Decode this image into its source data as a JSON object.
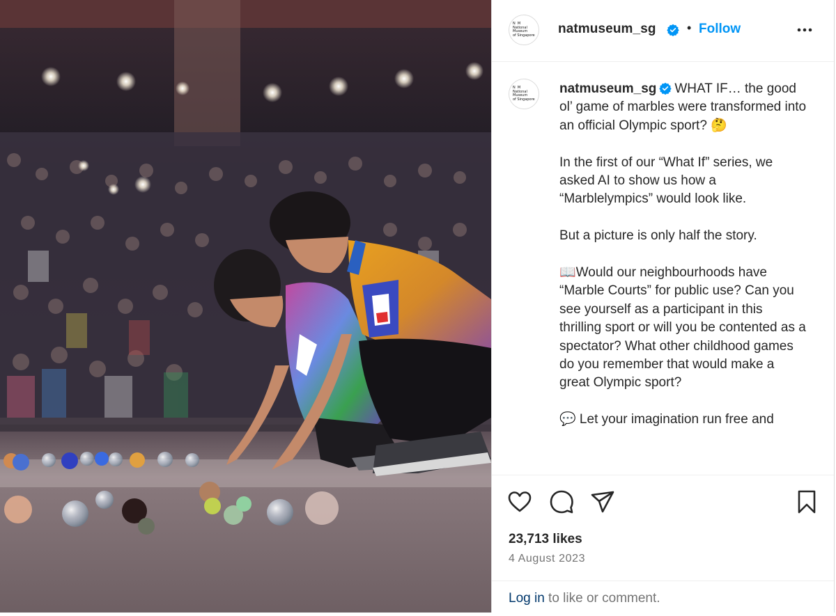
{
  "post": {
    "username": "natmuseum_sg",
    "avatar_alt": "National Museum of Singapore logo",
    "follow_label": "Follow",
    "separator": "•",
    "caption_paragraphs": [
      "WHAT IF… the good ol’ game of marbles were transformed into an official Olympic sport? 🤔",
      "In the first of our “What If” series, we asked AI to show us how a “Marblelympics” would look like.",
      "But a picture is only half the story.",
      "📖Would our neighbourhoods have “Marble Courts” for public use? Can you see yourself as a participant in this thrilling sport or will you be contented as a spectator? What other childhood games do you remember that would make a great Olympic sport?",
      "💬 Let your imagination run free and"
    ],
    "likes": "23,713 likes",
    "date": "4 August 2023",
    "login_link": "Log in",
    "login_rest": " to like or comment."
  },
  "icons": {
    "verified": "verified-badge-icon",
    "more": "more-options-icon",
    "like": "heart-icon",
    "comment": "comment-icon",
    "share": "share-icon",
    "save": "bookmark-icon"
  },
  "colors": {
    "follow": "#0095f6",
    "verified": "#0095f6",
    "link": "#00376b",
    "muted": "#737373",
    "text": "#262626"
  }
}
